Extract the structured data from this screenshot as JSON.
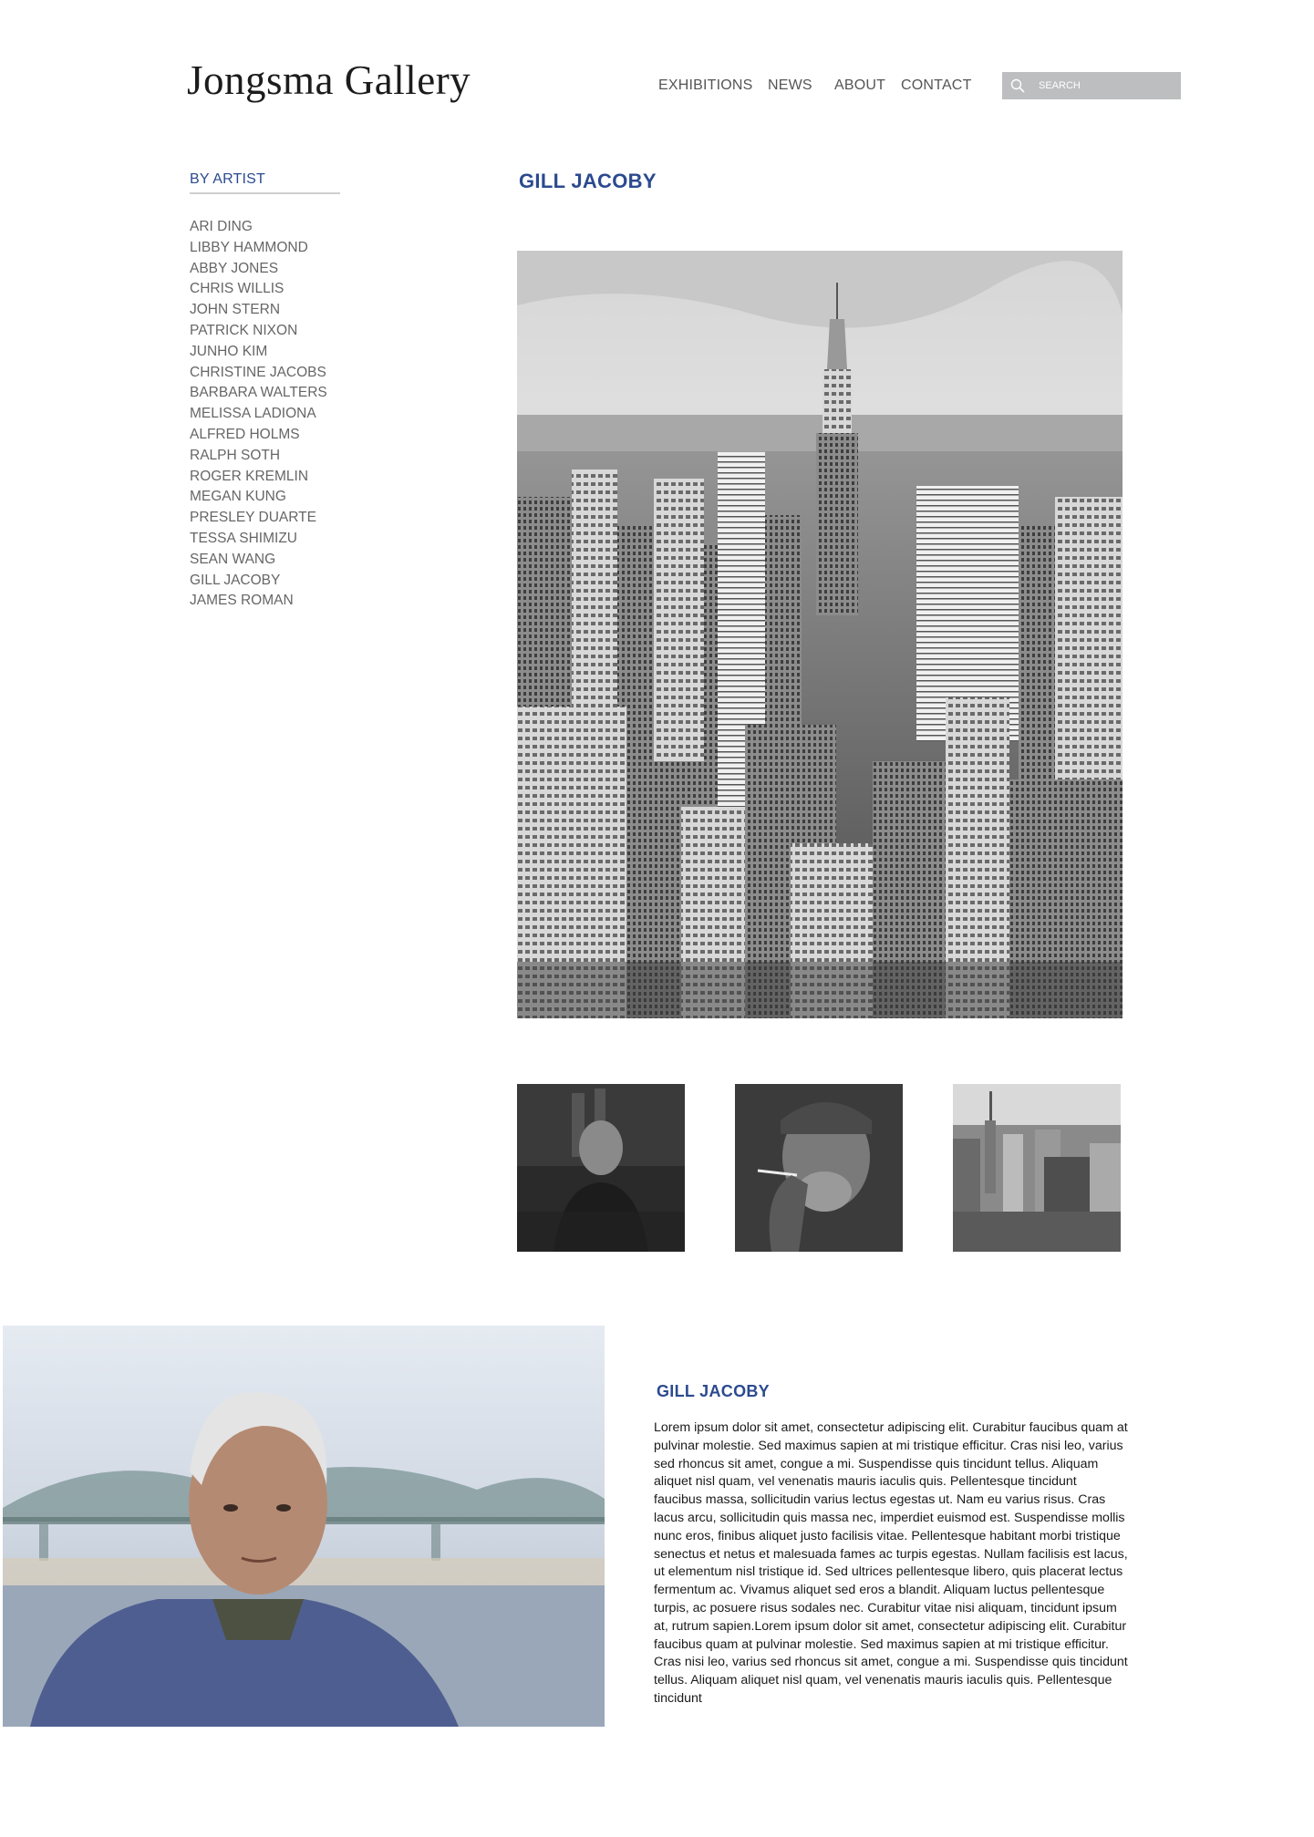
{
  "header": {
    "logo": "Jongsma Gallery",
    "nav": [
      {
        "label": "EXHIBITIONS"
      },
      {
        "label": "NEWS"
      },
      {
        "label": "ABOUT"
      },
      {
        "label": "CONTACT"
      }
    ],
    "search": {
      "placeholder": "SEARCH",
      "icon": "search-icon"
    }
  },
  "sidebar": {
    "heading": "BY ARTIST",
    "artists": [
      "ARI DING",
      "LIBBY HAMMOND",
      "ABBY JONES",
      "CHRIS WILLIS",
      "JOHN STERN",
      "PATRICK NIXON",
      "JUNHO KIM",
      "CHRISTINE JACOBS",
      "BARBARA WALTERS",
      "MELISSA LADIONA",
      "ALFRED HOLMS",
      "RALPH SOTH",
      "ROGER KREMLIN",
      "MEGAN KUNG",
      "PRESLEY DUARTE",
      "TESSA SHIMIZU",
      "SEAN WANG",
      "GILL JACOBY",
      "JAMES ROMAN"
    ]
  },
  "main": {
    "title": "GILL JACOBY",
    "hero_image": "black-and-white aerial city skyline photo",
    "thumbnails": [
      {
        "name": "man portrait in shadow"
      },
      {
        "name": "old man smoking portrait"
      },
      {
        "name": "city skyline"
      }
    ]
  },
  "bio": {
    "portrait_image": "elderly man portrait with bridge background",
    "title": "GILL JACOBY",
    "text": "Lorem ipsum dolor sit amet, consectetur adipiscing elit. Curabitur faucibus quam at pulvinar molestie. Sed maximus sapien at mi tristique efficitur. Cras nisi leo, varius sed rhoncus sit amet, congue a mi. Suspendisse quis tincidunt tellus. Aliquam aliquet nisl quam, vel venenatis mauris iaculis quis. Pellentesque tincidunt faucibus massa, sollicitudin varius lectus egestas ut. Nam eu varius risus. Cras lacus arcu, sollicitudin quis massa nec, imperdiet euismod est. Suspendisse mollis nunc eros, finibus aliquet justo facilisis vitae. Pellentesque habitant morbi tristique senectus et netus et malesuada fames ac turpis egestas. Nullam facilisis est lacus, ut elementum nisl tristique id. Sed ultrices pellentesque libero, quis placerat lectus fermentum ac. Vivamus aliquet sed eros a blandit. Aliquam luctus pellentesque turpis, ac posuere risus sodales nec. Curabitur vitae nisi aliquam, tincidunt ipsum at, rutrum sapien.Lorem ipsum dolor sit amet, consectetur adipiscing elit. Curabitur faucibus quam at pulvinar molestie. Sed maximus sapien at mi tristique efficitur. Cras nisi leo, varius sed rhoncus sit amet, congue a mi. Suspendisse quis tincidunt tellus. Aliquam aliquet nisl quam, vel venenatis mauris iaculis quis. Pellentesque tincidunt"
  },
  "colors": {
    "accent": "#2b4a8f",
    "text": "#555555",
    "search_bg": "#bdbec0"
  }
}
